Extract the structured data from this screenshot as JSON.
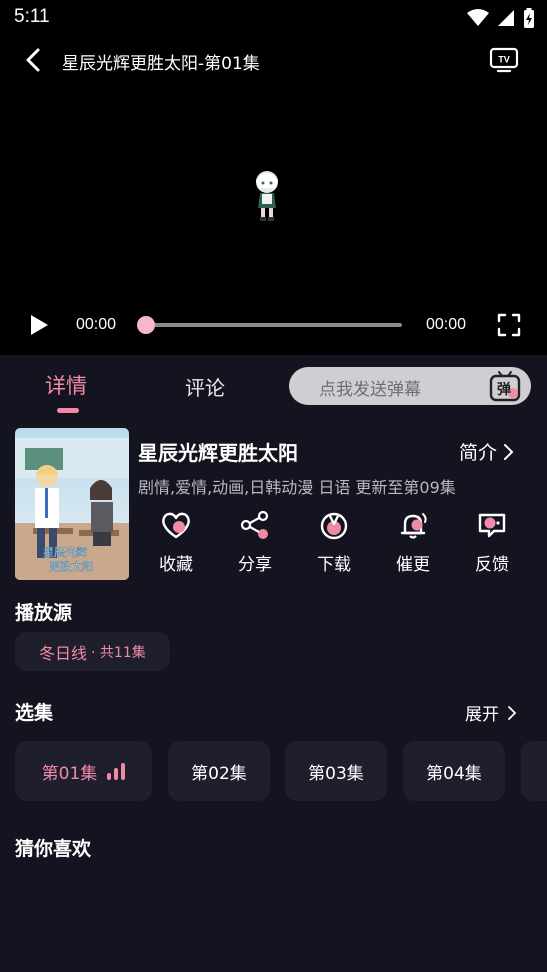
{
  "status_bar": {
    "time": "5:11",
    "icons": [
      "wifi-icon",
      "signal-icon",
      "battery-icon"
    ]
  },
  "player": {
    "title": "星辰光辉更胜太阳-第01集",
    "current_time": "00:00",
    "total_time": "00:00",
    "progress": 0
  },
  "tabs": {
    "detail": "详情",
    "comment": "评论",
    "active": "详情"
  },
  "danmaku": {
    "placeholder": "点我发送弹幕",
    "icon_label": "弹"
  },
  "anime": {
    "title": "星辰光辉更胜太阳",
    "intro_label": "简介",
    "tags": "剧情,爱情,动画,日韩动漫 日语 更新至第09集"
  },
  "actions": [
    {
      "label": "收藏",
      "icon": "heart-icon"
    },
    {
      "label": "分享",
      "icon": "share-icon"
    },
    {
      "label": "下载",
      "icon": "download-icon"
    },
    {
      "label": "催更",
      "icon": "bell-icon"
    },
    {
      "label": "反馈",
      "icon": "feedback-icon"
    }
  ],
  "source": {
    "section_title": "播放源",
    "name": "冬日线",
    "count": "· 共11集"
  },
  "episodes": {
    "section_title": "选集",
    "expand_label": "展开",
    "items": [
      "第01集",
      "第02集",
      "第03集",
      "第04集"
    ],
    "active": "第01集"
  },
  "recommend": {
    "section_title": "猜你喜欢"
  },
  "colors": {
    "accent": "#f08aa6",
    "background": "#141420",
    "card": "#1e1e2c"
  }
}
